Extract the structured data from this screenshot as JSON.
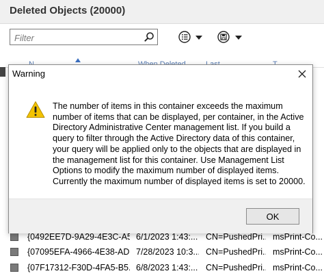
{
  "header": {
    "title": "Deleted Objects  (20000)"
  },
  "filter": {
    "placeholder": "Filter",
    "value": ""
  },
  "toolbar": {
    "icons": [
      "search-icon",
      "list-options-icon",
      "save-query-icon",
      "chevron-down-icon"
    ]
  },
  "columns": [
    "N",
    "When Deleted",
    "Last",
    "T"
  ],
  "rows": [
    {
      "guid": "{0492EE7D-9A29-4E3C-A5...",
      "when_deleted": "6/1/2023 1:43:...",
      "last_parent": "CN=PushedPri...",
      "type": "msPrint-Co..."
    },
    {
      "guid": "{07095EFA-4966-4E38-AD...",
      "when_deleted": "7/28/2023 10:3...",
      "last_parent": "CN=PushedPri...",
      "type": "msPrint-Co..."
    },
    {
      "guid": "{07F17312-F30D-4FA5-B5...",
      "when_deleted": "6/8/2023 1:43:...",
      "last_parent": "CN=PushedPri...",
      "type": "msPrint-Co..."
    }
  ],
  "dialog": {
    "title": "Warning",
    "message": "The number of items in this container exceeds the maximum number of items that can be displayed, per container, in the Active Directory Administrative Center management list. If you build a query to filter through the Active Directory data of this container, your query will be applied only to the objects that are displayed in the management list for this container. Use Management List Options to modify the maximum number of displayed items. Currently the maximum number of displayed items is set to 20000.",
    "ok_label": "OK",
    "icon": "warning-icon",
    "colors": {
      "warning": "#f3c300",
      "footer": "#f0f0f0"
    }
  }
}
